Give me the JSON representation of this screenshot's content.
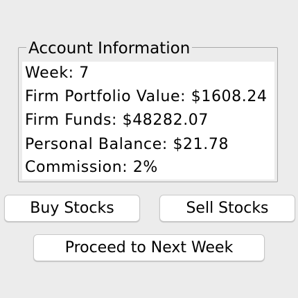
{
  "account_panel": {
    "title": "Account Information",
    "lines": [
      "Week: 7",
      "Firm Portfolio Value: $1608.24",
      "Firm Funds: $48282.07",
      "Personal Balance: $21.78",
      "Commission: 2%"
    ]
  },
  "actions": {
    "buy_label": "Buy Stocks",
    "sell_label": "Sell Stocks",
    "next_week_label": "Proceed to Next Week"
  }
}
